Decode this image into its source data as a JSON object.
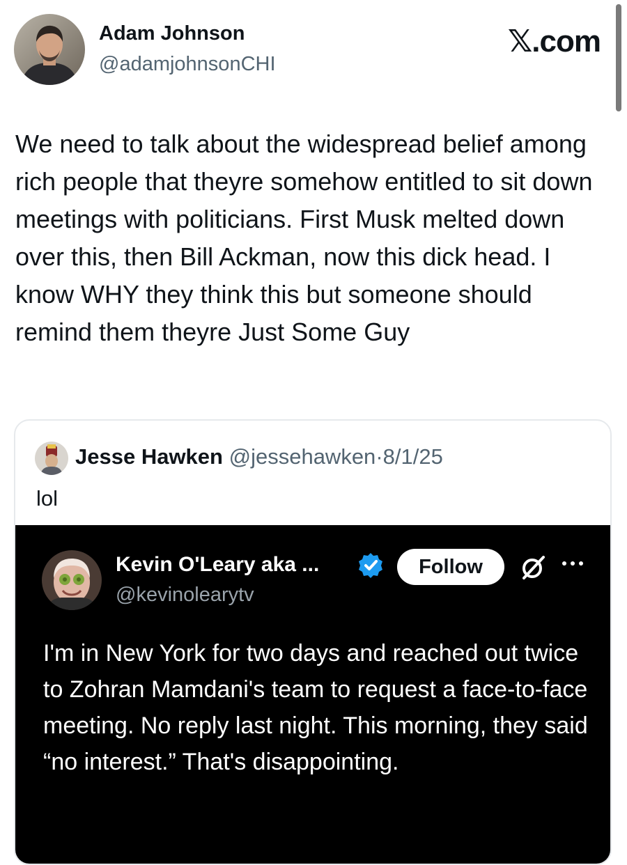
{
  "author": {
    "name": "Adam Johnson",
    "handle": "@adamjohnsonCHI"
  },
  "brand": "𝕏.com",
  "tweet": {
    "text": "We need to talk about the widespread belief among rich people that theyre somehow entitled to sit down meetings with politicians. First Musk melted down over this, then Bill Ackman, now this dick head. I know WHY they think this but someone should remind them theyre Just Some Guy"
  },
  "quote": {
    "name": "Jesse Hawken",
    "handle": "@jessehawken",
    "separator": "·",
    "date": "8/1/25",
    "text": "lol"
  },
  "embedded": {
    "name": "Kevin O'Leary aka ...",
    "handle": "@kevinolearytv",
    "follow_label": "Follow",
    "text": "I'm in New York for two days and reached out twice to Zohran Mamdani's team to request a face-to-face meeting. No reply last night. This morning, they said “no interest.” That's disappointing.",
    "verified_color": "#1d9bf0"
  },
  "icons": {
    "verified": "verified-badge-icon",
    "x_logo": "x-logo-icon",
    "more": "more-options-icon"
  }
}
